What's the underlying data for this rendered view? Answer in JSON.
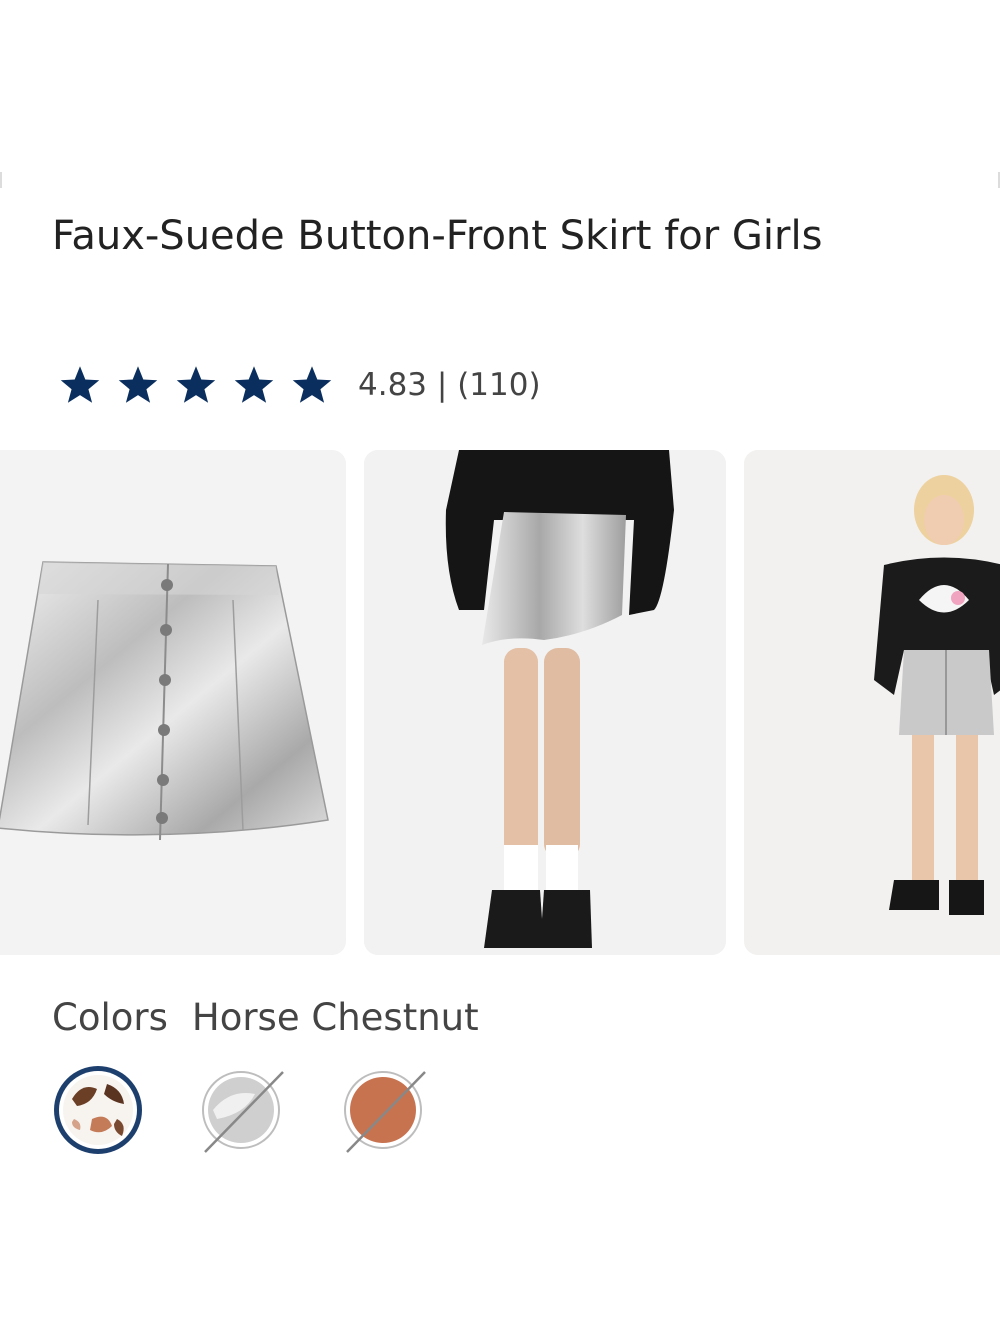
{
  "product": {
    "title": "Faux-Suede Button-Front Skirt for Girls",
    "rating_value": "4.83",
    "rating_separator": "|",
    "review_count": "(110)",
    "rating_text": "4.83 | (110)",
    "stars": 5,
    "star_color": "#0a2f5f"
  },
  "gallery": {
    "images": [
      {
        "name": "flat-lay-skirt-photo"
      },
      {
        "name": "model-back-view-photo"
      },
      {
        "name": "model-front-view-photo"
      }
    ]
  },
  "colors": {
    "label": "Colors",
    "selected_name": "Horse Chestnut",
    "swatches": [
      {
        "name": "horse-chestnut",
        "selected": true,
        "available": true,
        "color": "#ffffff"
      },
      {
        "name": "silver",
        "selected": false,
        "available": false,
        "color": "#c8c8c8"
      },
      {
        "name": "copper",
        "selected": false,
        "available": false,
        "color": "#c87350"
      }
    ],
    "selected_ring_color": "#1d3f6e"
  }
}
